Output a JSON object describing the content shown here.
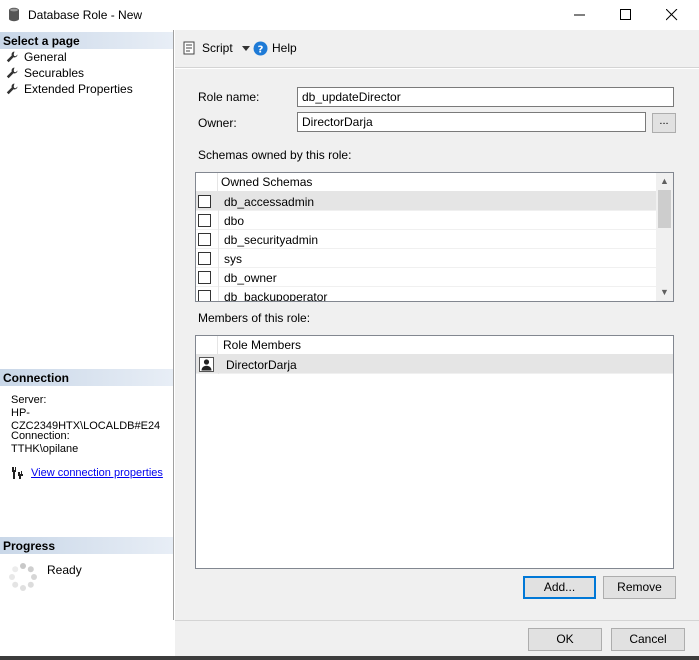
{
  "window": {
    "title": "Database Role - New"
  },
  "left": {
    "select_page_header": "Select a page",
    "pages": [
      "General",
      "Securables",
      "Extended Properties"
    ],
    "connection_header": "Connection",
    "server_label": "Server:",
    "server_value": "HP-CZC2349HTX\\LOCALDB#E24",
    "connection_label": "Connection:",
    "connection_value": "TTHK\\opilane",
    "view_props_link": "View connection properties",
    "progress_header": "Progress",
    "progress_status": "Ready"
  },
  "toolbar": {
    "script_label": "Script",
    "help_label": "Help"
  },
  "form": {
    "role_name_label": "Role name:",
    "role_name_value": "db_updateDirector",
    "owner_label": "Owner:",
    "owner_value": "DirectorDarja",
    "browse_label": "...",
    "schemas_label": "Schemas owned by this role:",
    "schemas_header": "Owned Schemas",
    "schemas": [
      "db_accessadmin",
      "dbo",
      "db_securityadmin",
      "sys",
      "db_owner",
      "db_backupoperator"
    ],
    "members_label": "Members of this role:",
    "members_header": "Role Members",
    "members": [
      "DirectorDarja"
    ],
    "add_button": "Add...",
    "remove_button": "Remove"
  },
  "footer": {
    "ok_button": "OK",
    "cancel_button": "Cancel"
  }
}
